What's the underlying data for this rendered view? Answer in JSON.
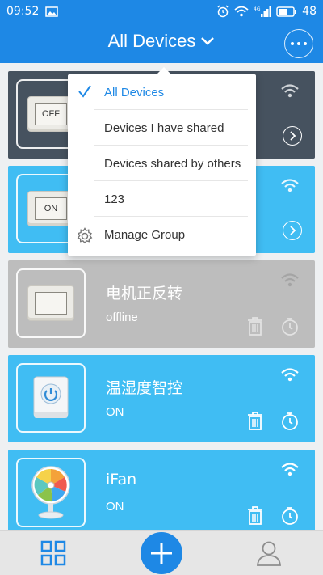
{
  "status_bar": {
    "time": "09:52",
    "battery": "48",
    "network": "4G"
  },
  "header": {
    "title": "All Devices"
  },
  "dropdown": {
    "items": [
      {
        "label": "All Devices",
        "selected": true
      },
      {
        "label": "Devices I have shared",
        "selected": false
      },
      {
        "label": "Devices shared by others",
        "selected": false
      },
      {
        "label": "123",
        "selected": false
      }
    ],
    "manage_label": "Manage Group"
  },
  "devices": [
    {
      "name": "",
      "status": "",
      "switch_label": "OFF",
      "color": "#46525f"
    },
    {
      "name": "",
      "status": "",
      "switch_label": "ON",
      "color": "#40bdf3"
    },
    {
      "name": "电机正反转",
      "status": "offline",
      "color": "#bdbdbd"
    },
    {
      "name": "温湿度智控",
      "status": "ON",
      "color": "#40bdf3"
    },
    {
      "name": "iFan",
      "status": "ON",
      "color": "#40bdf3"
    }
  ],
  "colors": {
    "primary": "#1e88e5",
    "card_online": "#40bdf3",
    "card_offline": "#bdbdbd",
    "card_dark": "#46525f"
  },
  "icons": {
    "bottom_left": "grid-icon",
    "bottom_center": "add-icon",
    "bottom_right": "user-icon"
  }
}
